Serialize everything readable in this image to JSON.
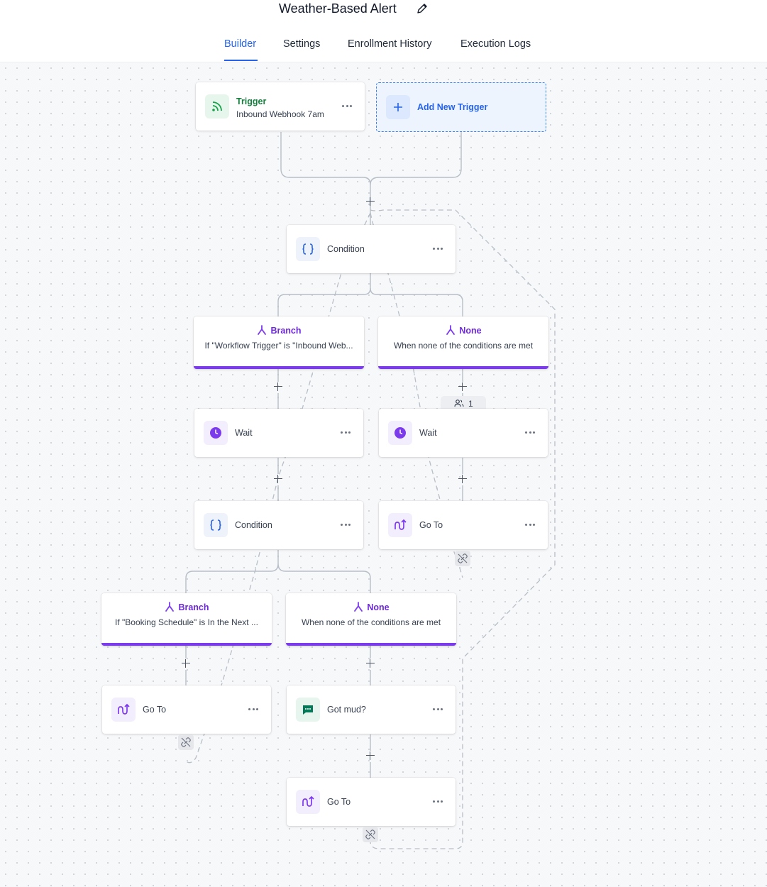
{
  "header": {
    "title": "Weather-Based Alert",
    "edit_icon": "pencil-icon"
  },
  "tabs": [
    {
      "label": "Builder",
      "active": true
    },
    {
      "label": "Settings",
      "active": false
    },
    {
      "label": "Enrollment History",
      "active": false
    },
    {
      "label": "Execution Logs",
      "active": false
    }
  ],
  "colors": {
    "accent": "#2563eb",
    "branch": "#7c3aed",
    "trigger": "#15803d",
    "message": "#047857"
  },
  "trigger": {
    "title": "Trigger",
    "subtitle": "Inbound Webhook 7am",
    "icon": "rss-icon"
  },
  "add_trigger": {
    "label": "Add New Trigger",
    "icon": "plus-icon"
  },
  "nodes": {
    "condition1": {
      "label": "Condition",
      "icon": "braces-icon"
    },
    "branch1": {
      "title": "Branch",
      "description": "If \"Workflow Trigger\" is \"Inbound Web...",
      "icon": "branch-icon"
    },
    "none1": {
      "title": "None",
      "description": "When none of the conditions are met",
      "icon": "branch-icon"
    },
    "wait_left": {
      "label": "Wait",
      "icon": "clock-icon"
    },
    "wait_right": {
      "label": "Wait",
      "icon": "clock-icon",
      "enrolled_count": "1"
    },
    "condition2": {
      "label": "Condition",
      "icon": "braces-icon"
    },
    "goto_right": {
      "label": "Go To",
      "icon": "goto-icon"
    },
    "branch2": {
      "title": "Branch",
      "description": "If \"Booking Schedule\" is In the Next ...",
      "icon": "branch-icon"
    },
    "none2": {
      "title": "None",
      "description": "When none of the conditions are met",
      "icon": "branch-icon"
    },
    "goto_left": {
      "label": "Go To",
      "icon": "goto-icon"
    },
    "message": {
      "label": "Got mud?",
      "icon": "message-icon"
    },
    "goto_bottom": {
      "label": "Go To",
      "icon": "goto-icon"
    }
  }
}
